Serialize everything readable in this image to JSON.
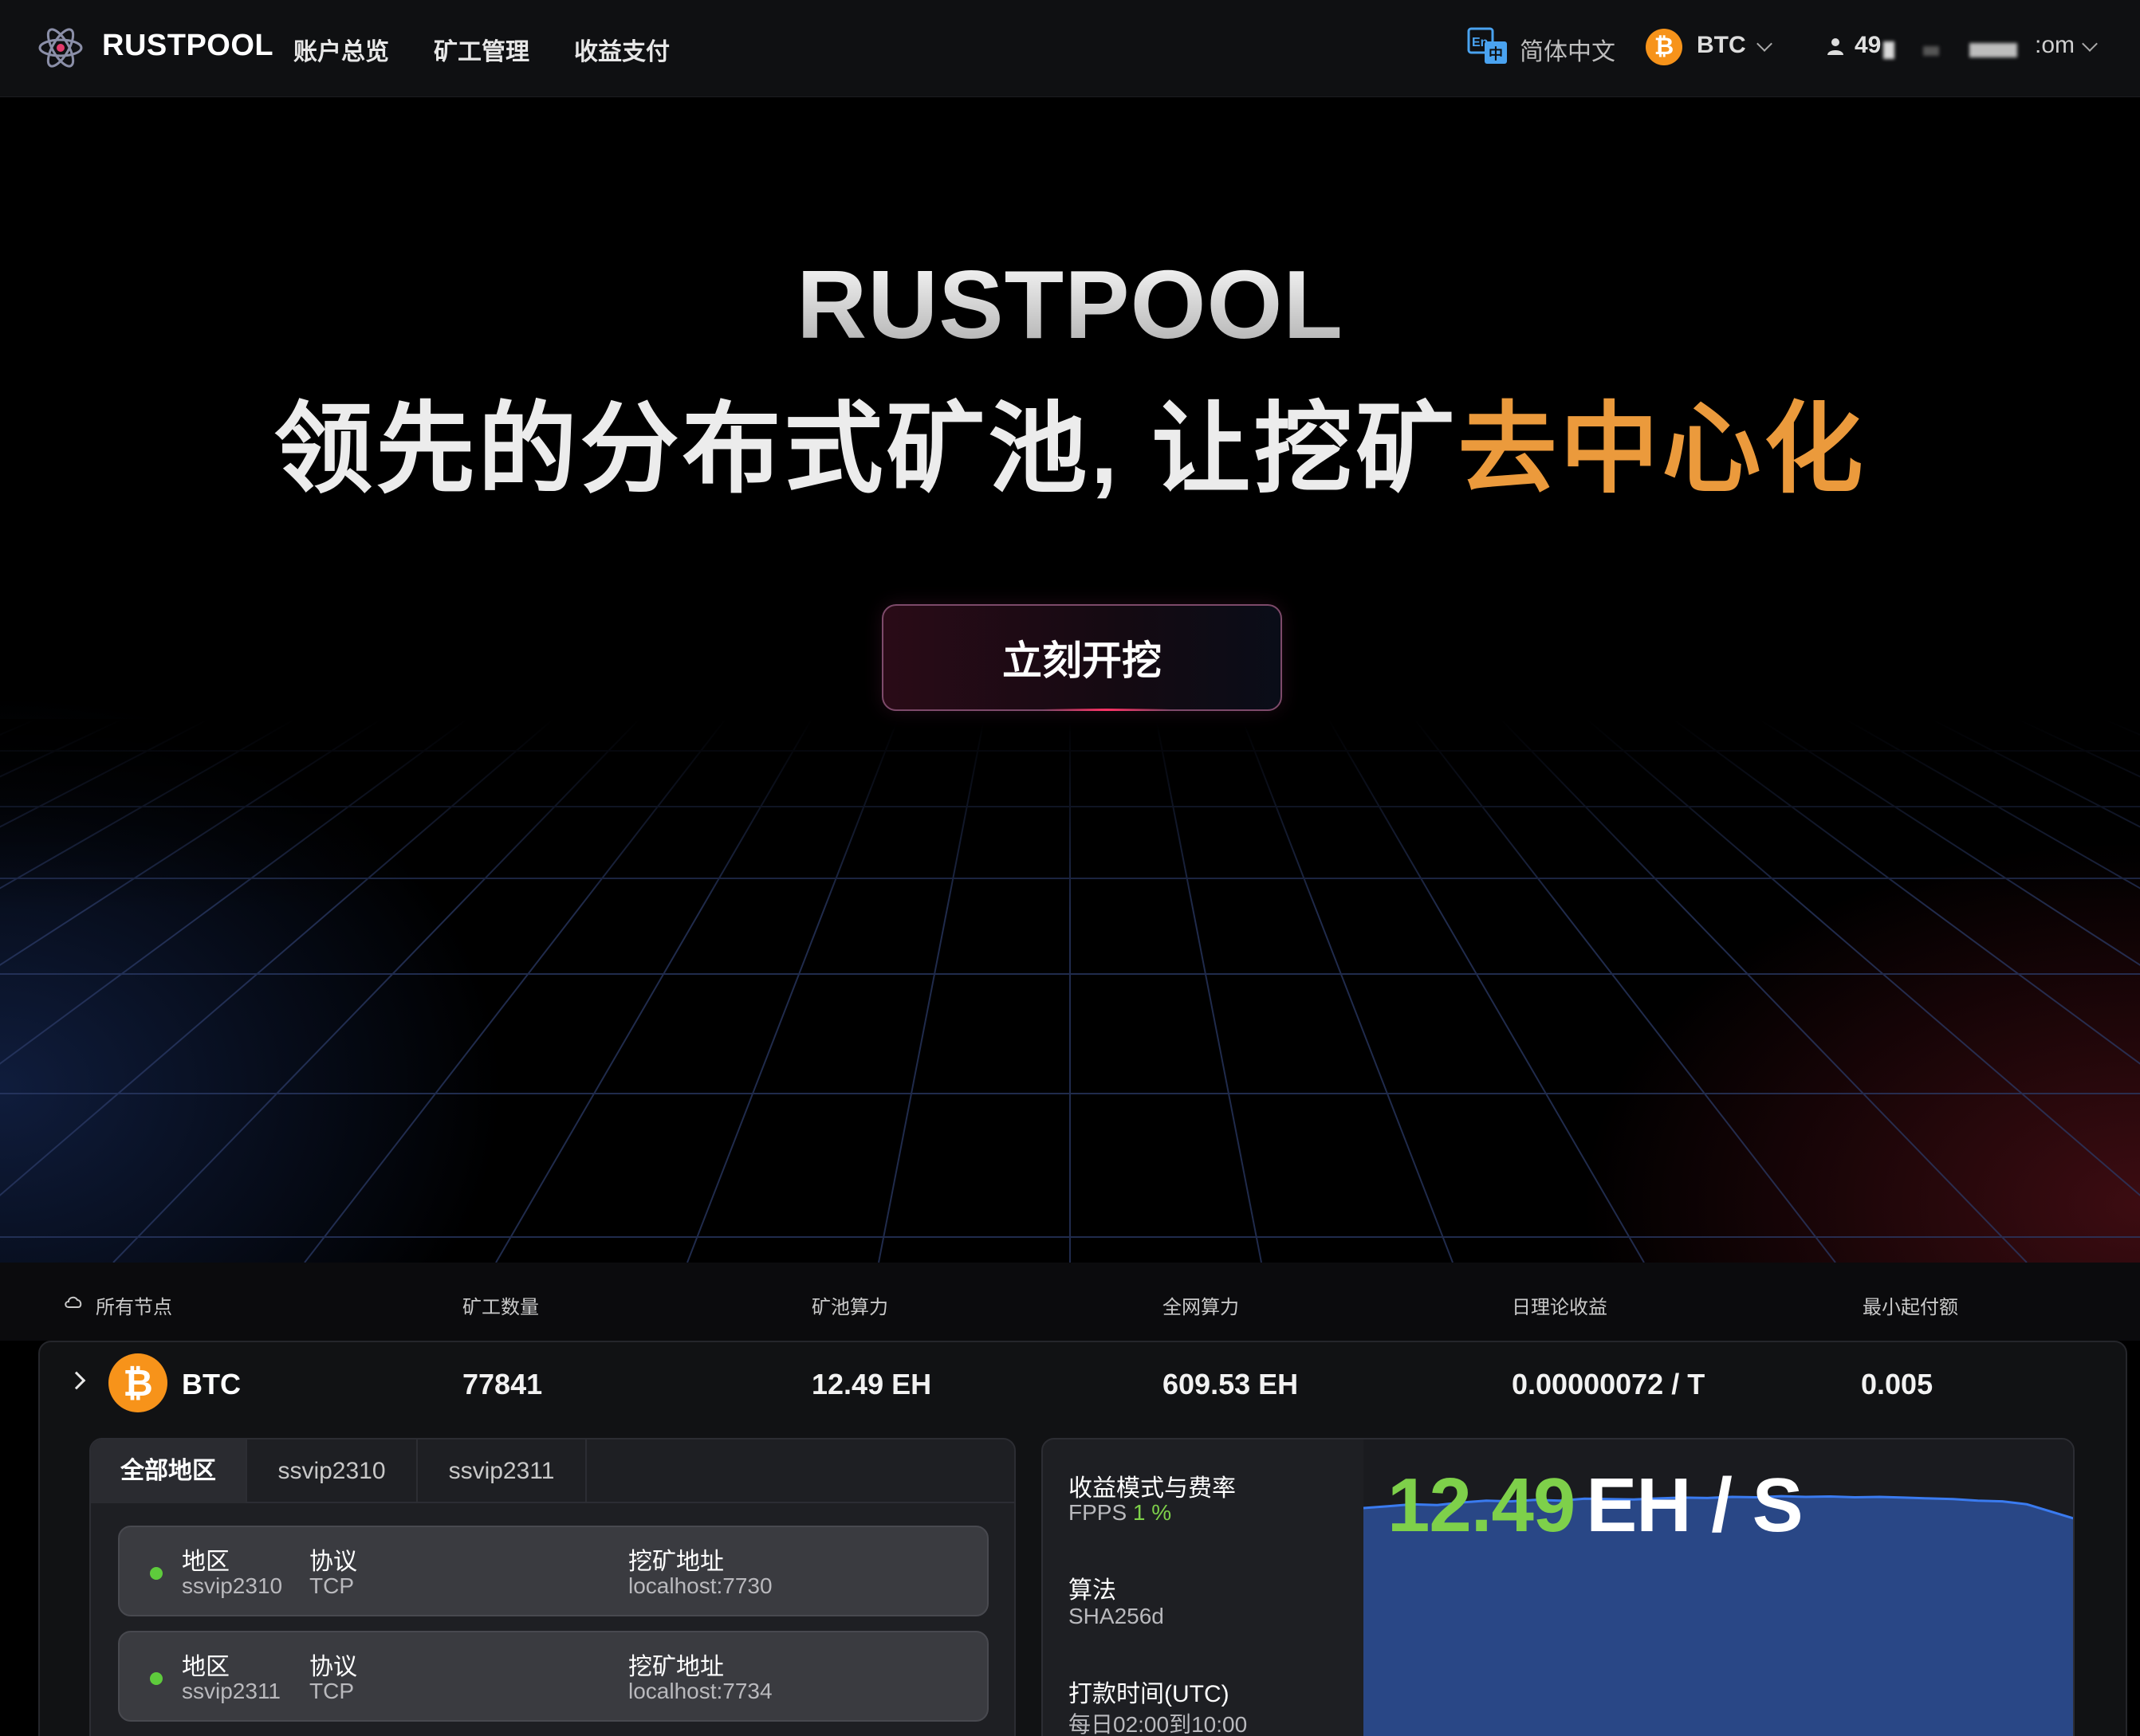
{
  "nav": {
    "brand": "RUSTPOOL",
    "menu": [
      "账户总览",
      "矿工管理",
      "收益支付"
    ],
    "language": "简体中文",
    "currency": "BTC",
    "user_visible_prefix": "49",
    "user_visible_suffix": ":om"
  },
  "hero": {
    "title": "RUSTPOOL",
    "subtitle_main": "领先的分布式矿池, 让挖矿",
    "subtitle_accent": "去中心化",
    "cta_label": "立刻开挖"
  },
  "stats": {
    "headers": [
      "所有节点",
      "矿工数量",
      "矿池算力",
      "全网算力",
      "日理论收益",
      "最小起付额"
    ],
    "coin": "BTC",
    "values": [
      "77841",
      "12.49 EH",
      "609.53 EH",
      "0.00000072 / T",
      "0.005"
    ]
  },
  "regions": {
    "tabs": [
      "全部地区",
      "ssvip2310",
      "ssvip2311"
    ],
    "labels": {
      "region": "地区",
      "protocol": "协议",
      "address": "挖矿地址"
    },
    "nodes": [
      {
        "region": "ssvip2310",
        "protocol": "TCP",
        "address": "localhost:7730"
      },
      {
        "region": "ssvip2311",
        "protocol": "TCP",
        "address": "localhost:7734"
      }
    ]
  },
  "info": {
    "mode_label": "收益模式与费率",
    "mode_value": "FPPS",
    "fee": "1 %",
    "algo_label": "算法",
    "algo_value": "SHA256d",
    "payout_label": "打款时间(UTC)",
    "payout_value": "每日02:00到10:00"
  },
  "hashrate": {
    "value": "12.49",
    "unit": "EH / S"
  },
  "colors": {
    "accent_orange": "#eb9a3c",
    "accent_green": "#7ed04a",
    "btc": "#f7931a",
    "chart_fill": "#2a4a8c",
    "chart_line": "#3a7bf0"
  },
  "chart_data": {
    "type": "area",
    "title": "",
    "series": [
      {
        "values": [
          12.2,
          12.25,
          12.3,
          12.28,
          12.35,
          12.4,
          12.38,
          12.42,
          12.4,
          12.45,
          12.44,
          12.43,
          12.46,
          12.48,
          12.47,
          12.5,
          12.49,
          12.52,
          12.5,
          12.51,
          12.49,
          12.5,
          12.48,
          12.46,
          12.44,
          12.4,
          12.38,
          12.3,
          12.1,
          11.9
        ]
      }
    ]
  }
}
